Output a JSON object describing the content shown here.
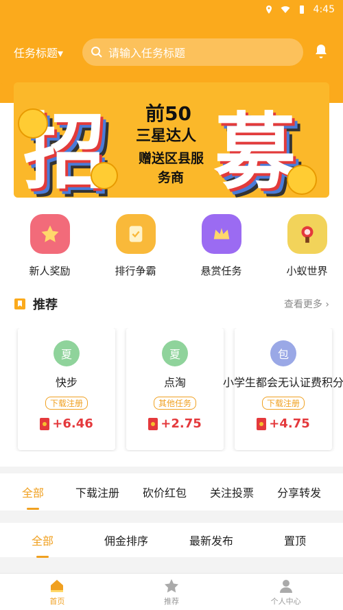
{
  "status": {
    "time": "4:45"
  },
  "header": {
    "type_label": "任务标题▾",
    "search_placeholder": "请输入任务标题"
  },
  "banner": {
    "char1": "招",
    "char2": "募",
    "line1": "前50",
    "line2": "三星达人",
    "line3": "赠送区县服",
    "line4": "务商"
  },
  "quick": [
    {
      "label": "新人奖励",
      "icon": "star-icon",
      "color": "#f26b7a"
    },
    {
      "label": "排行争霸",
      "icon": "document-icon",
      "color": "#f9b93a"
    },
    {
      "label": "悬赏任务",
      "icon": "crown-icon",
      "color": "#9b6bf2"
    },
    {
      "label": "小蚁世界",
      "icon": "game-icon",
      "color": "#f2d35a"
    }
  ],
  "recommend": {
    "title": "推荐",
    "more": "查看更多"
  },
  "cards": [
    {
      "avatar": "夏",
      "avatar_color": "#8fd39b",
      "name": "快步",
      "tag": "下载注册",
      "reward": "+6.46"
    },
    {
      "avatar": "夏",
      "avatar_color": "#8fd39b",
      "name": "点淘",
      "tag": "其他任务",
      "reward": "+2.75"
    },
    {
      "avatar": "包",
      "avatar_color": "#9aa8e6",
      "name": "小学生都会无认证费积分",
      "tag": "下载注册",
      "reward": "+4.75"
    }
  ],
  "tabs1": [
    "全部",
    "下载注册",
    "砍价红包",
    "关注投票",
    "分享转发"
  ],
  "tabs2": [
    "全部",
    "佣金排序",
    "最新发布",
    "置顶"
  ],
  "bottom_nav": [
    {
      "label": "首页",
      "icon": "home-icon"
    },
    {
      "label": "推荐",
      "icon": "star-icon"
    },
    {
      "label": "个人中心",
      "icon": "user-icon"
    }
  ]
}
